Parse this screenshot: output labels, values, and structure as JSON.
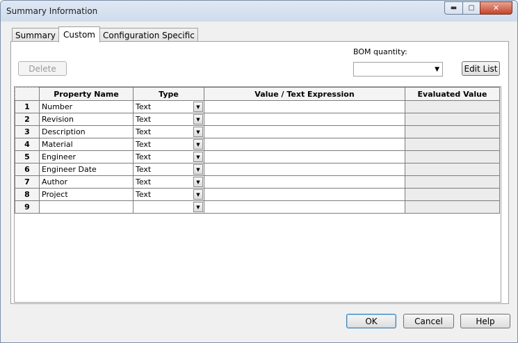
{
  "window": {
    "title": "Summary Information"
  },
  "tabs": [
    {
      "label": "Summary"
    },
    {
      "label": "Custom"
    },
    {
      "label": "Configuration Specific"
    }
  ],
  "toolbar": {
    "delete_label": "Delete",
    "bom_quantity_label": "BOM quantity:",
    "bom_quantity_value": "",
    "edit_list_label": "Edit List"
  },
  "table": {
    "headers": [
      "",
      "Property Name",
      "Type",
      "Value / Text Expression",
      "Evaluated Value"
    ],
    "rows": [
      {
        "num": "1",
        "name": "Number",
        "type": "Text",
        "value": "",
        "evaluated": ""
      },
      {
        "num": "2",
        "name": "Revision",
        "type": "Text",
        "value": "",
        "evaluated": ""
      },
      {
        "num": "3",
        "name": "Description",
        "type": "Text",
        "value": "",
        "evaluated": ""
      },
      {
        "num": "4",
        "name": "Material",
        "type": "Text",
        "value": "",
        "evaluated": ""
      },
      {
        "num": "5",
        "name": "Engineer",
        "type": "Text",
        "value": "",
        "evaluated": ""
      },
      {
        "num": "6",
        "name": "Engineer Date",
        "type": "Text",
        "value": "",
        "evaluated": ""
      },
      {
        "num": "7",
        "name": "Author",
        "type": "Text",
        "value": "",
        "evaluated": ""
      },
      {
        "num": "8",
        "name": "Project",
        "type": "Text",
        "value": "",
        "evaluated": ""
      },
      {
        "num": "9",
        "name": "",
        "type": "",
        "value": "",
        "evaluated": ""
      }
    ]
  },
  "buttons": {
    "ok": "OK",
    "cancel": "Cancel",
    "help": "Help"
  }
}
